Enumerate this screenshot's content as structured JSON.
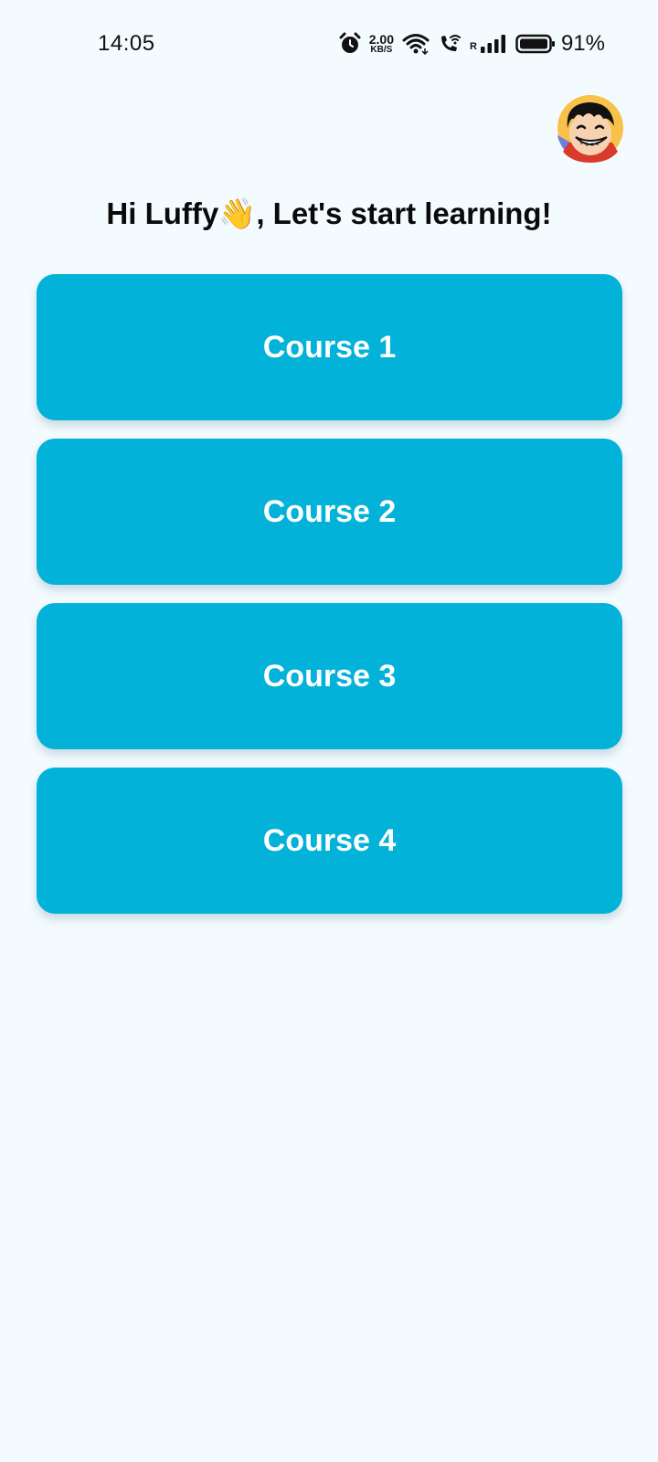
{
  "status_bar": {
    "time": "14:05",
    "net_speed_value": "2.00",
    "net_speed_unit": "KB/S",
    "signal_label": "R",
    "battery_percent": "91%",
    "icons": [
      "alarm-icon",
      "wifi-icon",
      "wifi-calling-icon",
      "signal-icon",
      "battery-icon"
    ]
  },
  "header": {
    "avatar": "luffy-avatar",
    "greeting": "Hi Luffy👋, Let's start learning!"
  },
  "courses": [
    {
      "label": "Course 1"
    },
    {
      "label": "Course 2"
    },
    {
      "label": "Course 3"
    },
    {
      "label": "Course 4"
    }
  ],
  "colors": {
    "background": "#f4fbfe",
    "card": "#03b2d8",
    "card_text": "#ffffff"
  }
}
